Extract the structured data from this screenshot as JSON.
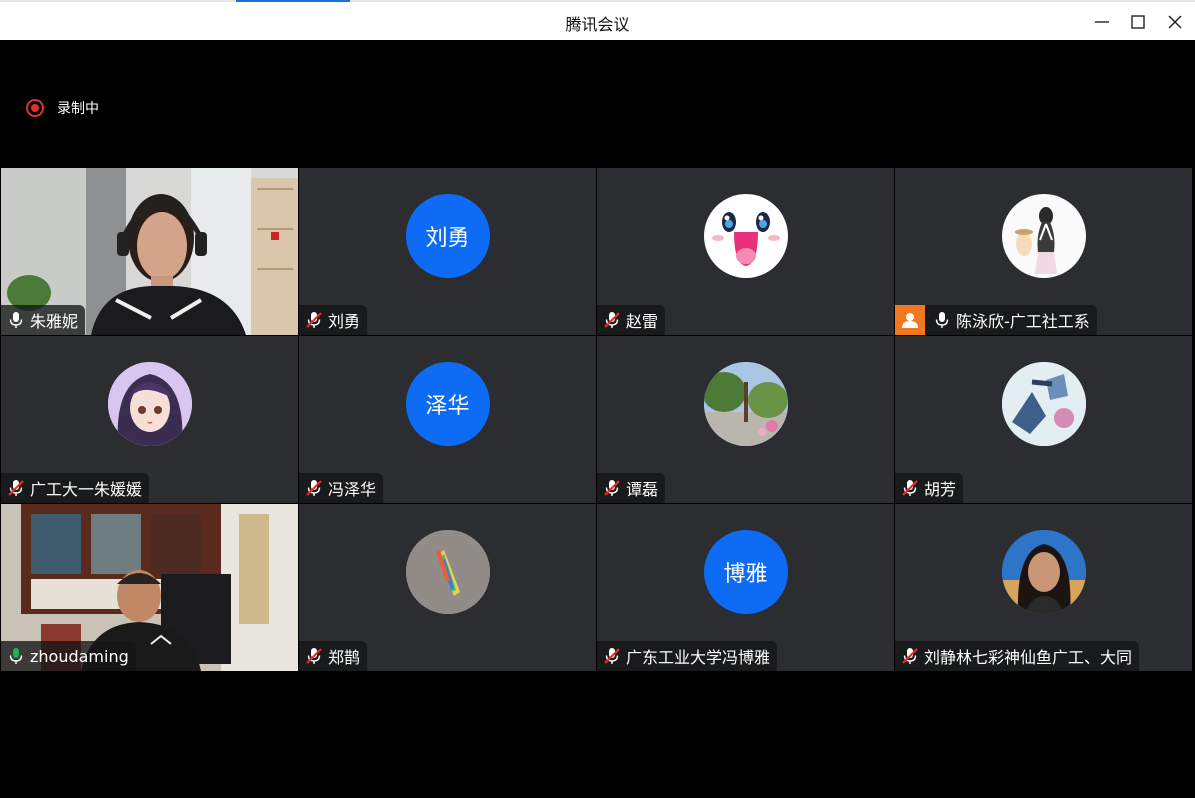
{
  "window": {
    "title": "腾讯会议"
  },
  "recording": {
    "label": "录制中"
  },
  "tiles": [
    {
      "name": "朱雅妮",
      "mic": "on"
    },
    {
      "name": "刘勇",
      "mic": "muted",
      "avatar_text": "刘勇"
    },
    {
      "name": "赵雷",
      "mic": "muted",
      "avatar_icon": "cartoon-face-icon"
    },
    {
      "name": "陈泳欣-广工社工系",
      "mic": "on",
      "host": true
    },
    {
      "name": "广工大一朱媛媛",
      "mic": "muted",
      "avatar_icon": "anime-girl-icon"
    },
    {
      "name": "冯泽华",
      "mic": "muted",
      "avatar_text": "泽华"
    },
    {
      "name": "谭磊",
      "mic": "muted",
      "avatar_icon": "garden-photo-icon"
    },
    {
      "name": "胡芳",
      "mic": "muted",
      "avatar_icon": "stickers-photo-icon"
    },
    {
      "name": "zhoudaming",
      "mic": "speaking"
    },
    {
      "name": "郑鹊",
      "mic": "muted",
      "avatar_icon": "rainbow-prism-icon"
    },
    {
      "name": "广东工业大学冯博雅",
      "mic": "muted",
      "avatar_text": "博雅"
    },
    {
      "name": "刘静林七彩神仙鱼广工、大同",
      "mic": "muted",
      "avatar_icon": "woman-portrait-icon"
    }
  ],
  "colors": {
    "accent": "#0e6cf4",
    "speaking": "#1fb24c",
    "recording": "#e0302a",
    "host": "#f07820",
    "tile_bg": "#2b2d31"
  }
}
